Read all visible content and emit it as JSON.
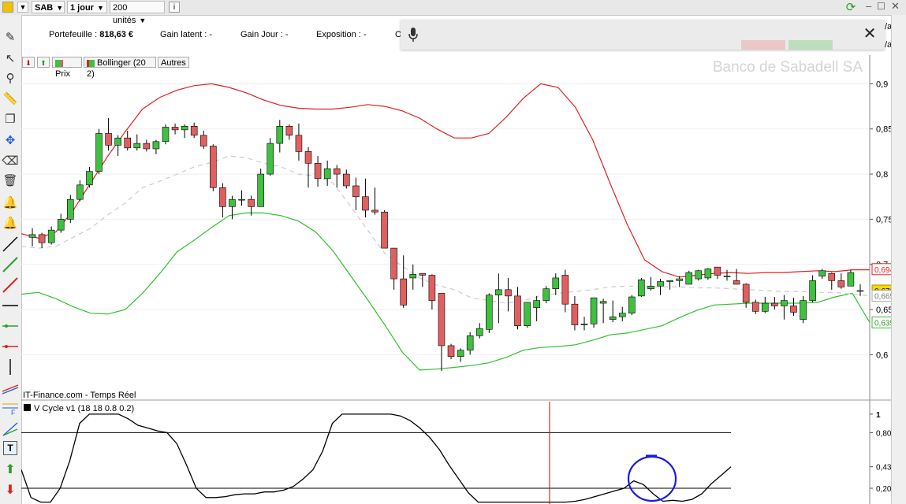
{
  "toolbar": {
    "symbol": "SAB",
    "period": "1 jour",
    "units": "200 unités",
    "info_icon": "info-icon"
  },
  "portfolio": {
    "portefeuille_label": "Portefeuille :",
    "portefeuille_value": "818,63 €",
    "gain_latent_label": "Gain latent :",
    "gain_latent_value": "-",
    "gain_jour_label": "Gain Jour :",
    "gain_jour_value": "-",
    "exposition_label": "Exposition :",
    "exposition_value": "-",
    "truncated_o": "O",
    "act1": "/act",
    "act2": "/act"
  },
  "legend": {
    "prix": "Prix",
    "bollinger": "Bollinger (20 2)",
    "autres": "Autres"
  },
  "watermark": "Banco de Sabadell SA",
  "source": "IT-Finance.com - Temps Réel",
  "indicator_title": "V Cycle v1 (18 18 0.8 0.2)",
  "price_axis": {
    "ticks": [
      "0,9",
      "0,85",
      "0,8",
      "0,75",
      "0,7",
      "0,65",
      "0,6"
    ],
    "tag_upper": "0,6947",
    "tag_last": "0,671",
    "tag_mid": "0,6652",
    "tag_lower": "0,6357"
  },
  "indicator_axis": {
    "ticks": [
      "1",
      "0,8000",
      "0,4321",
      "0,2000"
    ]
  },
  "colors": {
    "up": "#3fc03f",
    "down": "#e06060",
    "band_upper": "#e02020",
    "band_lower": "#30c030",
    "last_tag": "#f5d800",
    "annotation": "#1a1ae6"
  },
  "chart_data": {
    "type": "candlestick",
    "ylim": [
      0.555,
      0.93
    ],
    "candles": [
      [
        0.73,
        0.74,
        0.72,
        0.733
      ],
      [
        0.733,
        0.735,
        0.718,
        0.724
      ],
      [
        0.724,
        0.742,
        0.722,
        0.738
      ],
      [
        0.738,
        0.756,
        0.735,
        0.75
      ],
      [
        0.75,
        0.777,
        0.746,
        0.772
      ],
      [
        0.772,
        0.793,
        0.77,
        0.788
      ],
      [
        0.788,
        0.808,
        0.785,
        0.803
      ],
      [
        0.803,
        0.85,
        0.8,
        0.845
      ],
      [
        0.845,
        0.862,
        0.826,
        0.832
      ],
      [
        0.832,
        0.843,
        0.82,
        0.84
      ],
      [
        0.84,
        0.848,
        0.826,
        0.829
      ],
      [
        0.829,
        0.844,
        0.826,
        0.834
      ],
      [
        0.834,
        0.838,
        0.825,
        0.828
      ],
      [
        0.828,
        0.838,
        0.822,
        0.836
      ],
      [
        0.836,
        0.855,
        0.833,
        0.852
      ],
      [
        0.852,
        0.856,
        0.844,
        0.849
      ],
      [
        0.849,
        0.855,
        0.84,
        0.853
      ],
      [
        0.853,
        0.857,
        0.84,
        0.843
      ],
      [
        0.843,
        0.848,
        0.828,
        0.831
      ],
      [
        0.831,
        0.833,
        0.781,
        0.785
      ],
      [
        0.785,
        0.79,
        0.752,
        0.764
      ],
      [
        0.764,
        0.776,
        0.75,
        0.772
      ],
      [
        0.772,
        0.782,
        0.765,
        0.772
      ],
      [
        0.772,
        0.776,
        0.754,
        0.764
      ],
      [
        0.764,
        0.806,
        0.764,
        0.8
      ],
      [
        0.8,
        0.84,
        0.798,
        0.834
      ],
      [
        0.834,
        0.86,
        0.824,
        0.853
      ],
      [
        0.853,
        0.855,
        0.838,
        0.843
      ],
      [
        0.843,
        0.856,
        0.815,
        0.825
      ],
      [
        0.825,
        0.83,
        0.785,
        0.812
      ],
      [
        0.812,
        0.82,
        0.786,
        0.795
      ],
      [
        0.795,
        0.815,
        0.787,
        0.806
      ],
      [
        0.806,
        0.81,
        0.785,
        0.8
      ],
      [
        0.8,
        0.805,
        0.784,
        0.787
      ],
      [
        0.787,
        0.796,
        0.76,
        0.775
      ],
      [
        0.775,
        0.795,
        0.752,
        0.76
      ],
      [
        0.76,
        0.785,
        0.755,
        0.758
      ],
      [
        0.758,
        0.76,
        0.72,
        0.718
      ],
      [
        0.718,
        0.705,
        0.672,
        0.684
      ],
      [
        0.684,
        0.71,
        0.652,
        0.655
      ],
      [
        0.685,
        0.7,
        0.672,
        0.689
      ],
      [
        0.69,
        0.688,
        0.675,
        0.688
      ],
      [
        0.688,
        0.689,
        0.65,
        0.66
      ],
      [
        0.668,
        0.652,
        0.582,
        0.61
      ],
      [
        0.61,
        0.612,
        0.595,
        0.598
      ],
      [
        0.598,
        0.607,
        0.592,
        0.605
      ],
      [
        0.605,
        0.625,
        0.6,
        0.621
      ],
      [
        0.621,
        0.635,
        0.618,
        0.629
      ],
      [
        0.628,
        0.668,
        0.624,
        0.666
      ],
      [
        0.666,
        0.69,
        0.635,
        0.672
      ],
      [
        0.672,
        0.685,
        0.648,
        0.665
      ],
      [
        0.665,
        0.675,
        0.628,
        0.632
      ],
      [
        0.632,
        0.657,
        0.63,
        0.658
      ],
      [
        0.652,
        0.665,
        0.637,
        0.66
      ],
      [
        0.66,
        0.676,
        0.657,
        0.673
      ],
      [
        0.673,
        0.69,
        0.666,
        0.685
      ],
      [
        0.688,
        0.694,
        0.647,
        0.656
      ],
      [
        0.656,
        0.665,
        0.627,
        0.633
      ],
      [
        0.633,
        0.642,
        0.627,
        0.634
      ],
      [
        0.634,
        0.662,
        0.63,
        0.663
      ],
      [
        0.657,
        0.662,
        0.635,
        0.659
      ],
      [
        0.639,
        0.66,
        0.636,
        0.642
      ],
      [
        0.642,
        0.653,
        0.637,
        0.646
      ],
      [
        0.646,
        0.666,
        0.644,
        0.664
      ],
      [
        0.665,
        0.685,
        0.664,
        0.683
      ],
      [
        0.673,
        0.686,
        0.671,
        0.676
      ],
      [
        0.676,
        0.684,
        0.666,
        0.681
      ],
      [
        0.681,
        0.676,
        0.672,
        0.682
      ],
      [
        0.682,
        0.687,
        0.675,
        0.684
      ],
      [
        0.678,
        0.693,
        0.679,
        0.691
      ],
      [
        0.684,
        0.694,
        0.682,
        0.693
      ],
      [
        0.685,
        0.696,
        0.683,
        0.695
      ],
      [
        0.697,
        0.696,
        0.684,
        0.688
      ],
      [
        0.687,
        0.694,
        0.682,
        0.687
      ],
      [
        0.682,
        0.695,
        0.679,
        0.678
      ],
      [
        0.678,
        0.679,
        0.652,
        0.658
      ],
      [
        0.658,
        0.661,
        0.645,
        0.648
      ],
      [
        0.648,
        0.664,
        0.646,
        0.657
      ],
      [
        0.657,
        0.664,
        0.65,
        0.654
      ],
      [
        0.654,
        0.666,
        0.639,
        0.66
      ],
      [
        0.654,
        0.663,
        0.643,
        0.647
      ],
      [
        0.639,
        0.665,
        0.635,
        0.66
      ],
      [
        0.66,
        0.688,
        0.658,
        0.682
      ],
      [
        0.687,
        0.695,
        0.684,
        0.693
      ],
      [
        0.69,
        0.691,
        0.672,
        0.682
      ],
      [
        0.682,
        0.69,
        0.673,
        0.675
      ],
      [
        0.676,
        0.694,
        0.676,
        0.691
      ],
      [
        0.671,
        0.678,
        0.665,
        0.671
      ]
    ],
    "series": [
      {
        "name": "upper_band",
        "values": [
          0.734,
          0.729,
          0.736,
          0.76,
          0.79,
          0.82,
          0.847,
          0.872,
          0.885,
          0.893,
          0.898,
          0.9,
          0.896,
          0.89,
          0.882,
          0.876,
          0.873,
          0.872,
          0.872,
          0.874,
          0.877,
          0.875,
          0.87,
          0.862,
          0.85,
          0.84,
          0.84,
          0.845,
          0.863,
          0.884,
          0.9,
          0.896,
          0.874,
          0.838,
          0.79,
          0.744,
          0.705,
          0.692,
          0.686,
          0.688,
          0.69,
          0.691,
          0.69,
          0.691,
          0.691,
          0.692,
          0.693,
          0.692,
          0.694,
          0.694
        ]
      },
      {
        "name": "lower_band",
        "values": [
          0.667,
          0.669,
          0.662,
          0.653,
          0.646,
          0.645,
          0.65,
          0.668,
          0.69,
          0.714,
          0.727,
          0.741,
          0.754,
          0.757,
          0.757,
          0.754,
          0.748,
          0.736,
          0.715,
          0.688,
          0.661,
          0.633,
          0.603,
          0.583,
          0.584,
          0.586,
          0.588,
          0.591,
          0.597,
          0.605,
          0.608,
          0.609,
          0.611,
          0.616,
          0.622,
          0.624,
          0.628,
          0.632,
          0.641,
          0.649,
          0.655,
          0.656,
          0.657,
          0.657,
          0.657,
          0.657,
          0.658,
          0.664,
          0.668,
          0.6357
        ]
      },
      {
        "name": "middle_band",
        "values": [
          0.72,
          0.718,
          0.72,
          0.73,
          0.74,
          0.755,
          0.768,
          0.785,
          0.792,
          0.8,
          0.808,
          0.813,
          0.82,
          0.818,
          0.812,
          0.808,
          0.8,
          0.798,
          0.79,
          0.765,
          0.738,
          0.712,
          0.698,
          0.685,
          0.677,
          0.672,
          0.663,
          0.66,
          0.657,
          0.66,
          0.665,
          0.668,
          0.67,
          0.672,
          0.675,
          0.676,
          0.675,
          0.675,
          0.675,
          0.674,
          0.674,
          0.673,
          0.672,
          0.671,
          0.67,
          0.67,
          0.669,
          0.669,
          0.667,
          0.6652
        ]
      },
      {
        "name": "v_cycle",
        "values": [
          0.4,
          0.1,
          0.05,
          0.05,
          0.2,
          0.5,
          0.9,
          1.0,
          1.0,
          1.0,
          1.0,
          0.95,
          0.88,
          0.85,
          0.82,
          0.8,
          0.68,
          0.45,
          0.2,
          0.1,
          0.1,
          0.11,
          0.13,
          0.14,
          0.14,
          0.16,
          0.16,
          0.18,
          0.22,
          0.3,
          0.4,
          0.6,
          0.9,
          1.0,
          1.0,
          1.0,
          1.0,
          1.0,
          1.0,
          0.98,
          0.93,
          0.85,
          0.75,
          0.62,
          0.45,
          0.3,
          0.15,
          0.05,
          0.05,
          0.05,
          0.05,
          0.05,
          0.05,
          0.05,
          0.05,
          0.05,
          0.05,
          0.06,
          0.08,
          0.11,
          0.14,
          0.17,
          0.2,
          0.28,
          0.24,
          0.14,
          0.06,
          0.07,
          0.06,
          0.08,
          0.14,
          0.25,
          0.34,
          0.4321
        ]
      }
    ],
    "indicator_levels": [
      0.8,
      0.2
    ],
    "indicator_ylim": [
      0.03,
      1.05
    ]
  }
}
